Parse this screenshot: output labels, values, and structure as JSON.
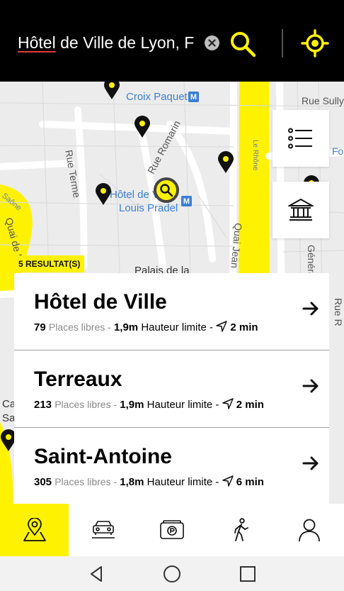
{
  "search": {
    "query_part1": "Hôtel",
    "query_part2": " de Ville de Lyon,  F",
    "search_icon": "search-icon",
    "clear_icon": "clear-icon",
    "locate_icon": "locate-icon"
  },
  "map": {
    "labels": {
      "croix_paquet": "Croix Paquet",
      "rue_sully": "Rue Sully",
      "rue_terme": "Rue Terme",
      "rue_romarin": "Rue Romarin",
      "le_rhone": "Le Rhône",
      "hotel_de_ville": "Hôtel de Vi",
      "louis_pradel": "Louis Pradel",
      "saone": "Saône",
      "quai_de": "Quai de S",
      "quai_jean": "Quai Jean",
      "palais": "Palais de la",
      "general": "Général",
      "rue_r": "Rue R",
      "fo": "Fo",
      "ca": "Ca",
      "sa": "Sa"
    },
    "metro_letter": "M",
    "results_badge": "5 RESULTAT(S)",
    "list_button_icon": "list-icon",
    "museum_button_icon": "museum-icon",
    "colors": {
      "river": "#fff200",
      "map_bg": "#ececec",
      "road": "#ffffff",
      "pin": "#111111"
    }
  },
  "results": [
    {
      "name": "Hôtel de Ville",
      "places": "79",
      "places_label": "Places libres -",
      "height": "1,9m",
      "height_label": "Hauteur limite -",
      "time": "2 min"
    },
    {
      "name": "Terreaux",
      "places": "213",
      "places_label": "Places libres -",
      "height": "1,9m",
      "height_label": "Hauteur limite -",
      "time": "2 min"
    },
    {
      "name": "Saint-Antoine",
      "places": "305",
      "places_label": "Places libres -",
      "height": "1,8m",
      "height_label": "Hauteur limite -",
      "time": "6 min"
    }
  ],
  "tabs": [
    {
      "icon": "map-pin-tab-icon",
      "active": true
    },
    {
      "icon": "car-tab-icon",
      "active": false
    },
    {
      "icon": "parking-card-tab-icon",
      "active": false
    },
    {
      "icon": "walking-tab-icon",
      "active": false
    },
    {
      "icon": "profile-tab-icon",
      "active": false
    }
  ],
  "system_nav": [
    "back-icon",
    "home-icon",
    "recents-icon"
  ]
}
